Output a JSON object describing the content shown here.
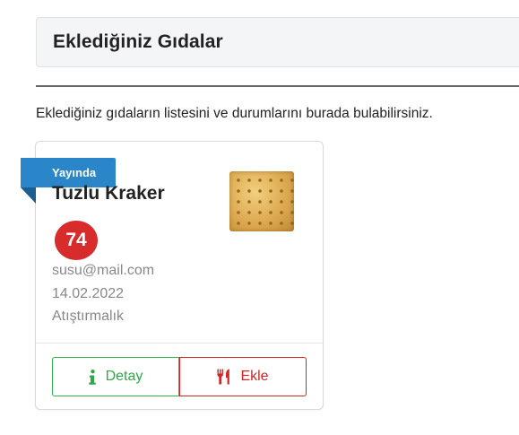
{
  "page": {
    "title": "Eklediğiniz Gıdalar",
    "description": "Eklediğiniz gıdaların listesini ve durumlarını burada bulabilirsiniz."
  },
  "foods": [
    {
      "status_badge": "Yayında",
      "name": "Tuzlu Kraker",
      "score": "74",
      "email": "susu@mail.com",
      "date": "14.02.2022",
      "category": "Atıştırmalık",
      "detail_label": "Detay",
      "add_label": "Ekle"
    }
  ],
  "colors": {
    "badge": "#2a86c9",
    "score": "#d82b2b",
    "detail": "#2fa84a",
    "add": "#d02626"
  },
  "icons": {
    "detail": "info-icon",
    "add": "utensils-icon"
  }
}
